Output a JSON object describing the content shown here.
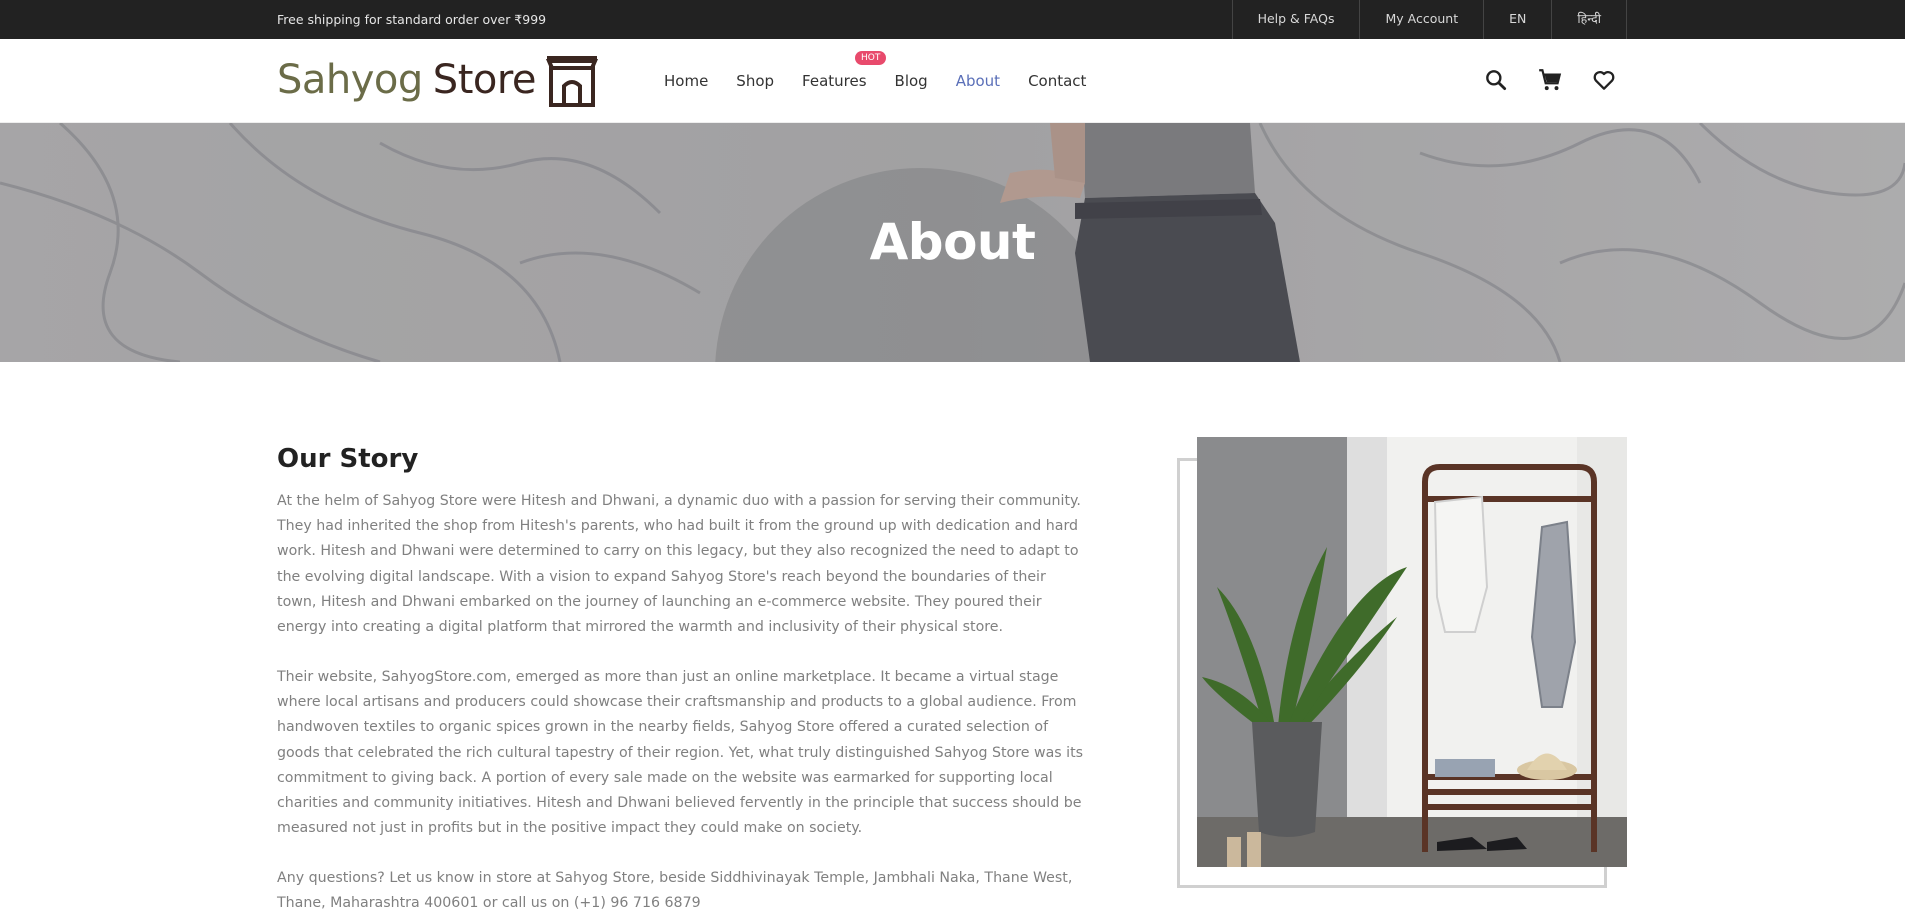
{
  "topbar": {
    "shipping_text": "Free shipping for standard order over ₹999",
    "links": [
      "Help & FAQs",
      "My Account",
      "EN",
      "हिन्दी"
    ]
  },
  "header": {
    "logo_word1": "Sahyog",
    "logo_word2": "Store",
    "nav": [
      {
        "label": "Home"
      },
      {
        "label": "Shop"
      },
      {
        "label": "Features",
        "badge": "HOT"
      },
      {
        "label": "Blog"
      },
      {
        "label": "About",
        "active": true
      },
      {
        "label": "Contact"
      }
    ],
    "icons": [
      "search-icon",
      "cart-icon",
      "heart-icon"
    ]
  },
  "hero": {
    "title": "About"
  },
  "story": {
    "title": "Our Story",
    "paragraphs": [
      "At the helm of Sahyog Store were Hitesh and Dhwani, a dynamic duo with a passion for serving their community. They had inherited the shop from Hitesh's parents, who had built it from the ground up with dedication and hard work. Hitesh and Dhwani were determined to carry on this legacy, but they also recognized the need to adapt to the evolving digital landscape. With a vision to expand Sahyog Store's reach beyond the boundaries of their town, Hitesh and Dhwani embarked on the journey of launching an e-commerce website. They poured their energy into creating a digital platform that mirrored the warmth and inclusivity of their physical store.",
      "Their website, SahyogStore.com, emerged as more than just an online marketplace. It became a virtual stage where local artisans and producers could showcase their craftsmanship and products to a global audience. From handwoven textiles to organic spices grown in the nearby fields, Sahyog Store offered a curated selection of goods that celebrated the rich cultural tapestry of their region. Yet, what truly distinguished Sahyog Store was its commitment to giving back. A portion of every sale made on the website was earmarked for supporting local charities and community initiatives. Hitesh and Dhwani believed fervently in the principle that success should be measured not just in profits but in the positive impact they could make on society.",
      "Any questions? Let us know in store at Sahyog Store, beside Siddhivinayak Temple, Jambhali Naka, Thane West, Thane, Maharashtra 400601 or call us on (+1) 96 716 6879"
    ]
  },
  "colors": {
    "topbar_bg": "#222222",
    "nav_active": "#5a6fb8",
    "hot_badge": "#e84a6c",
    "logo_olive": "#6b6c48",
    "logo_brown": "#3a2620"
  }
}
